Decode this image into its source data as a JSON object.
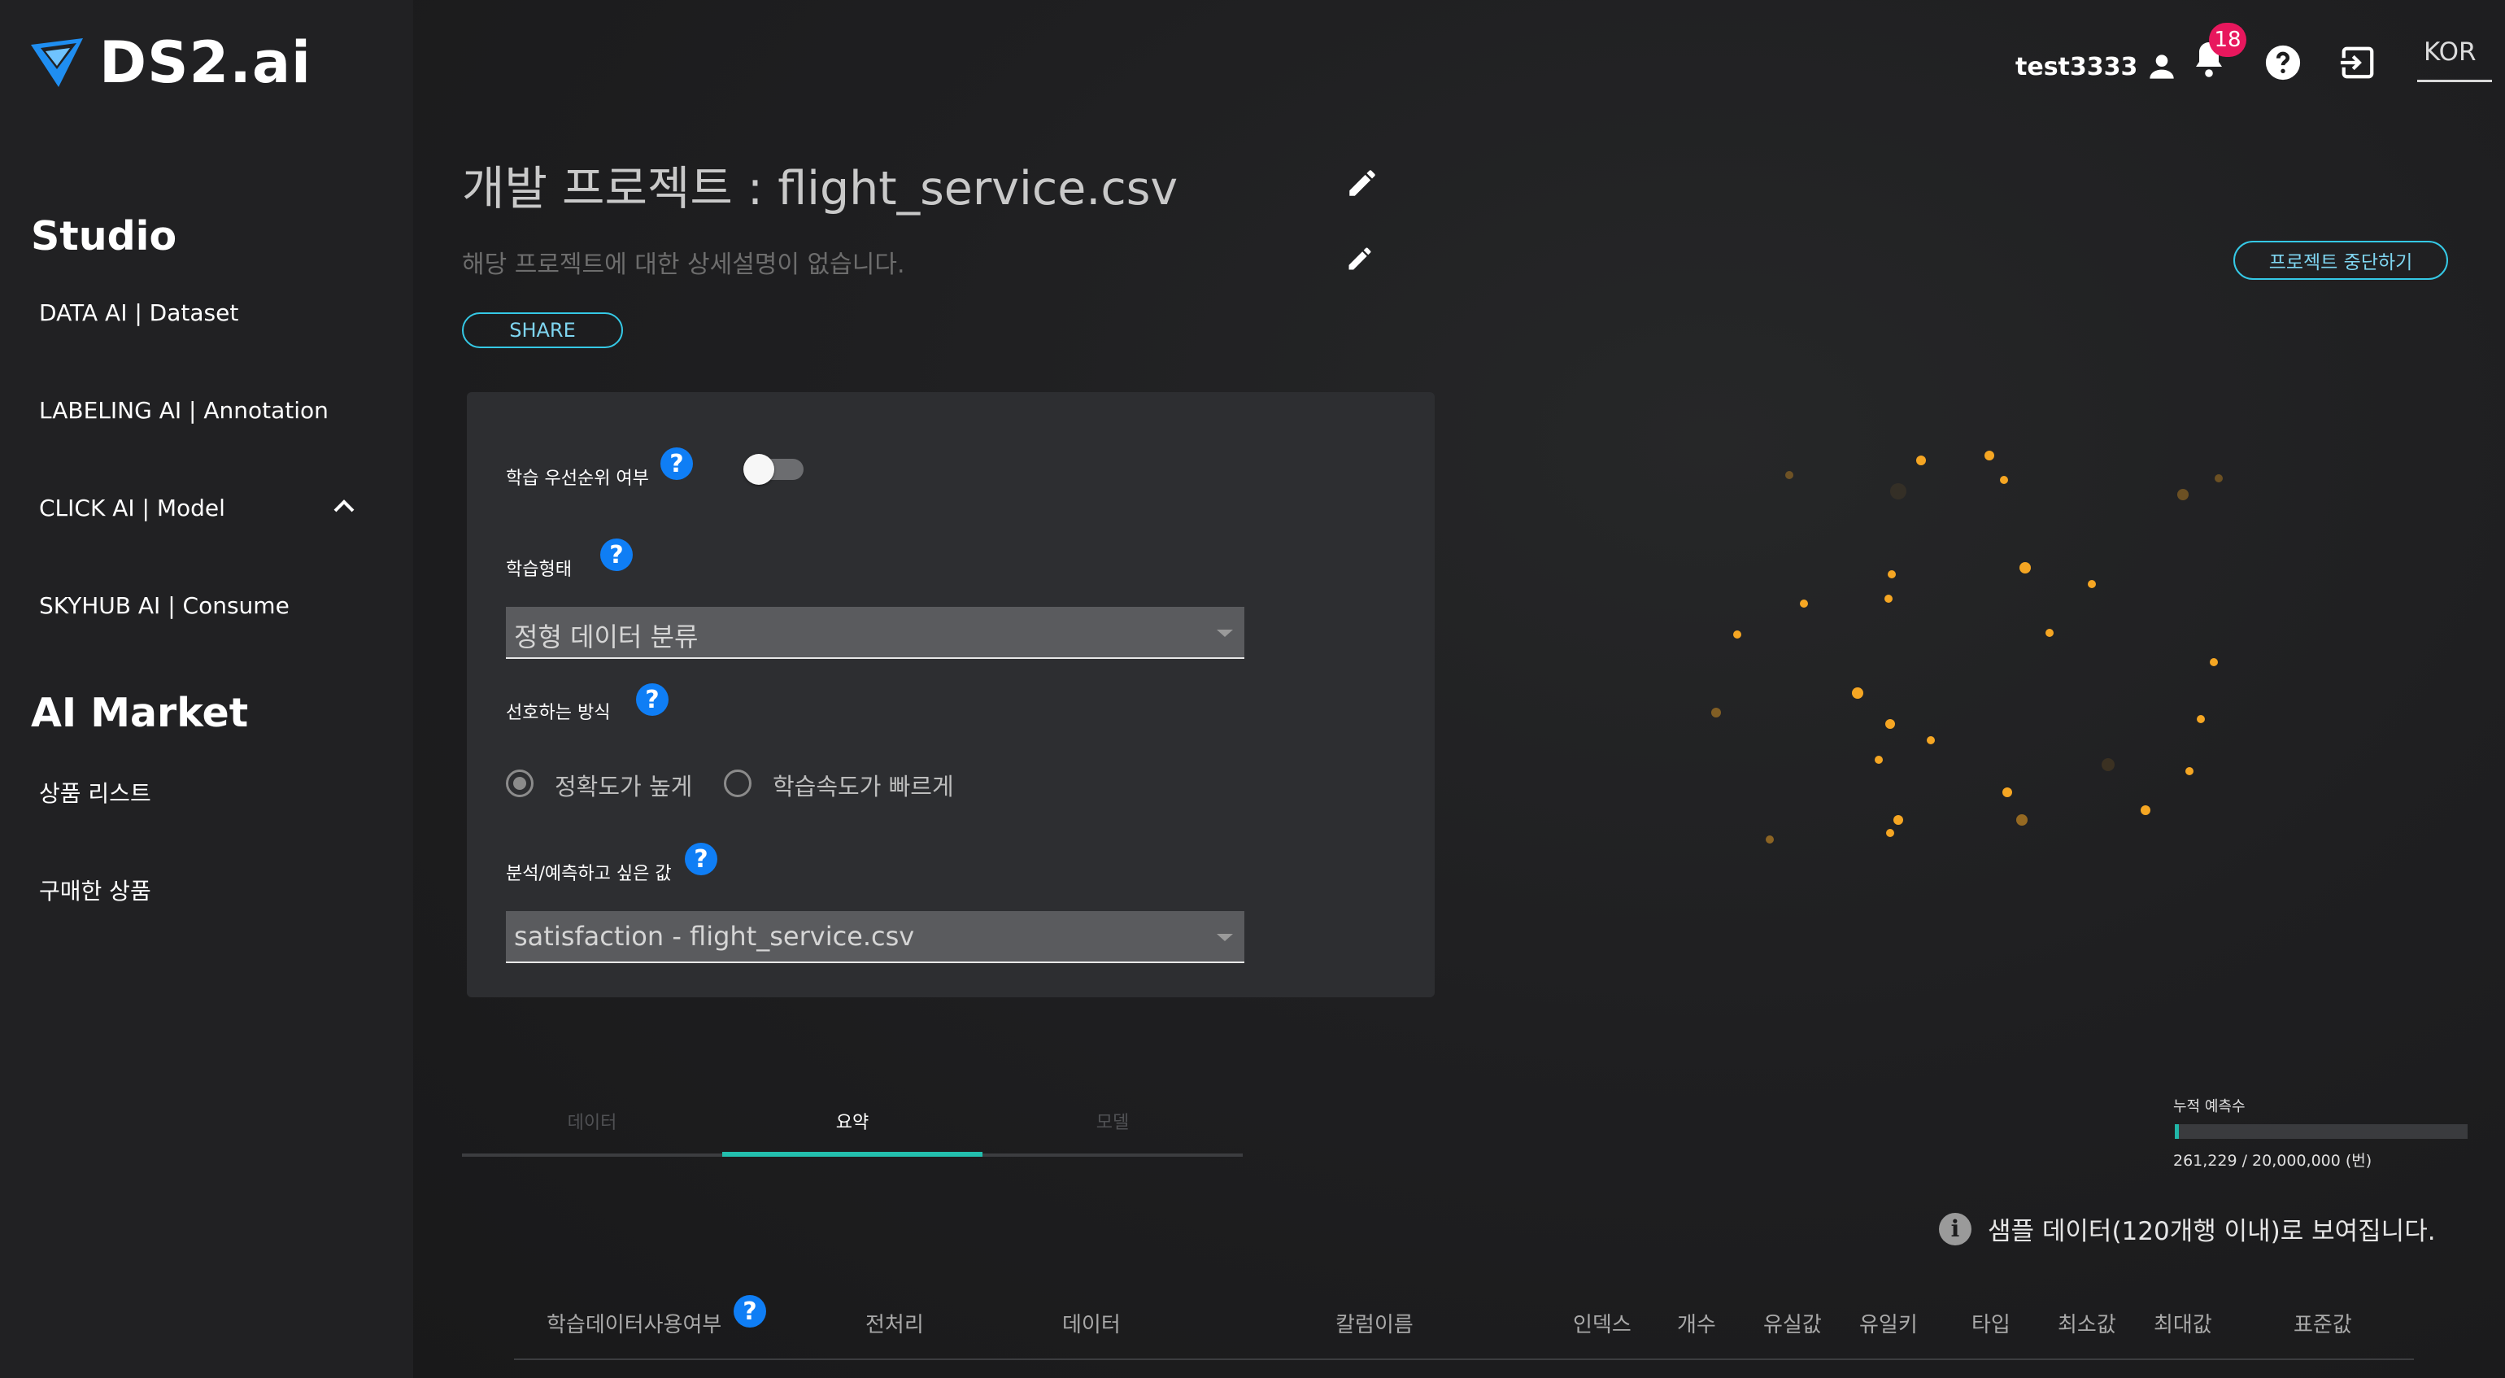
{
  "app": {
    "logo_text": "DS2.ai"
  },
  "sidebar": {
    "studio_title": "Studio",
    "items": [
      {
        "label": "DATA AI | Dataset"
      },
      {
        "label": "LABELING AI | Annotation"
      },
      {
        "label": "CLICK AI | Model"
      },
      {
        "label": "SKYHUB AI | Consume"
      }
    ],
    "market_title": "AI Market",
    "market_items": [
      {
        "label": "상품 리스트"
      },
      {
        "label": "구매한 상품"
      }
    ]
  },
  "header": {
    "username": "test3333",
    "notification_count": "18",
    "language": "KOR",
    "icons": [
      "user-icon",
      "bell-icon",
      "help-icon",
      "logout-icon"
    ]
  },
  "project": {
    "title": "개발 프로젝트 : flight_service.csv",
    "description": "해당 프로젝트에 대한 상세설명이 없습니다.",
    "share_label": "SHARE",
    "stop_label": "프로젝트 중단하기"
  },
  "settings": {
    "priority_label": "학습 우선순위 여부",
    "priority_enabled": false,
    "train_type_label": "학습형태",
    "train_type_value": "정형 데이터 분류",
    "preferred_label": "선호하는 방식",
    "radio_accuracy": "정확도가 높게",
    "radio_speed": "학습속도가 빠르게",
    "radio_selected": "accuracy",
    "target_label": "분석/예측하고 싶은 값",
    "target_value": "satisfaction - flight_service.csv",
    "help_glyph": "?"
  },
  "tabs": [
    {
      "label": "데이터",
      "active": false
    },
    {
      "label": "요약",
      "active": true
    },
    {
      "label": "모델",
      "active": false
    }
  ],
  "usage": {
    "label": "누적 예측수",
    "value_text": "261,229 / 20,000,000 (번)",
    "fraction": 0.013
  },
  "sample_note": "샘플 데이터(120개행 이내)로 보여집니다.",
  "table": {
    "headers": [
      "학습데이터사용여부",
      "전처리",
      "데이터",
      "칼럼이름",
      "인덱스",
      "개수",
      "유실값",
      "유일키",
      "타입",
      "최소값",
      "최대값",
      "표준값"
    ]
  },
  "colors": {
    "accent_cyan": "#35c9e6",
    "accent_teal": "#23bfae",
    "help_blue": "#0f7ef5",
    "badge_pink": "#e8175d",
    "dot_orange": "#f5a623"
  }
}
